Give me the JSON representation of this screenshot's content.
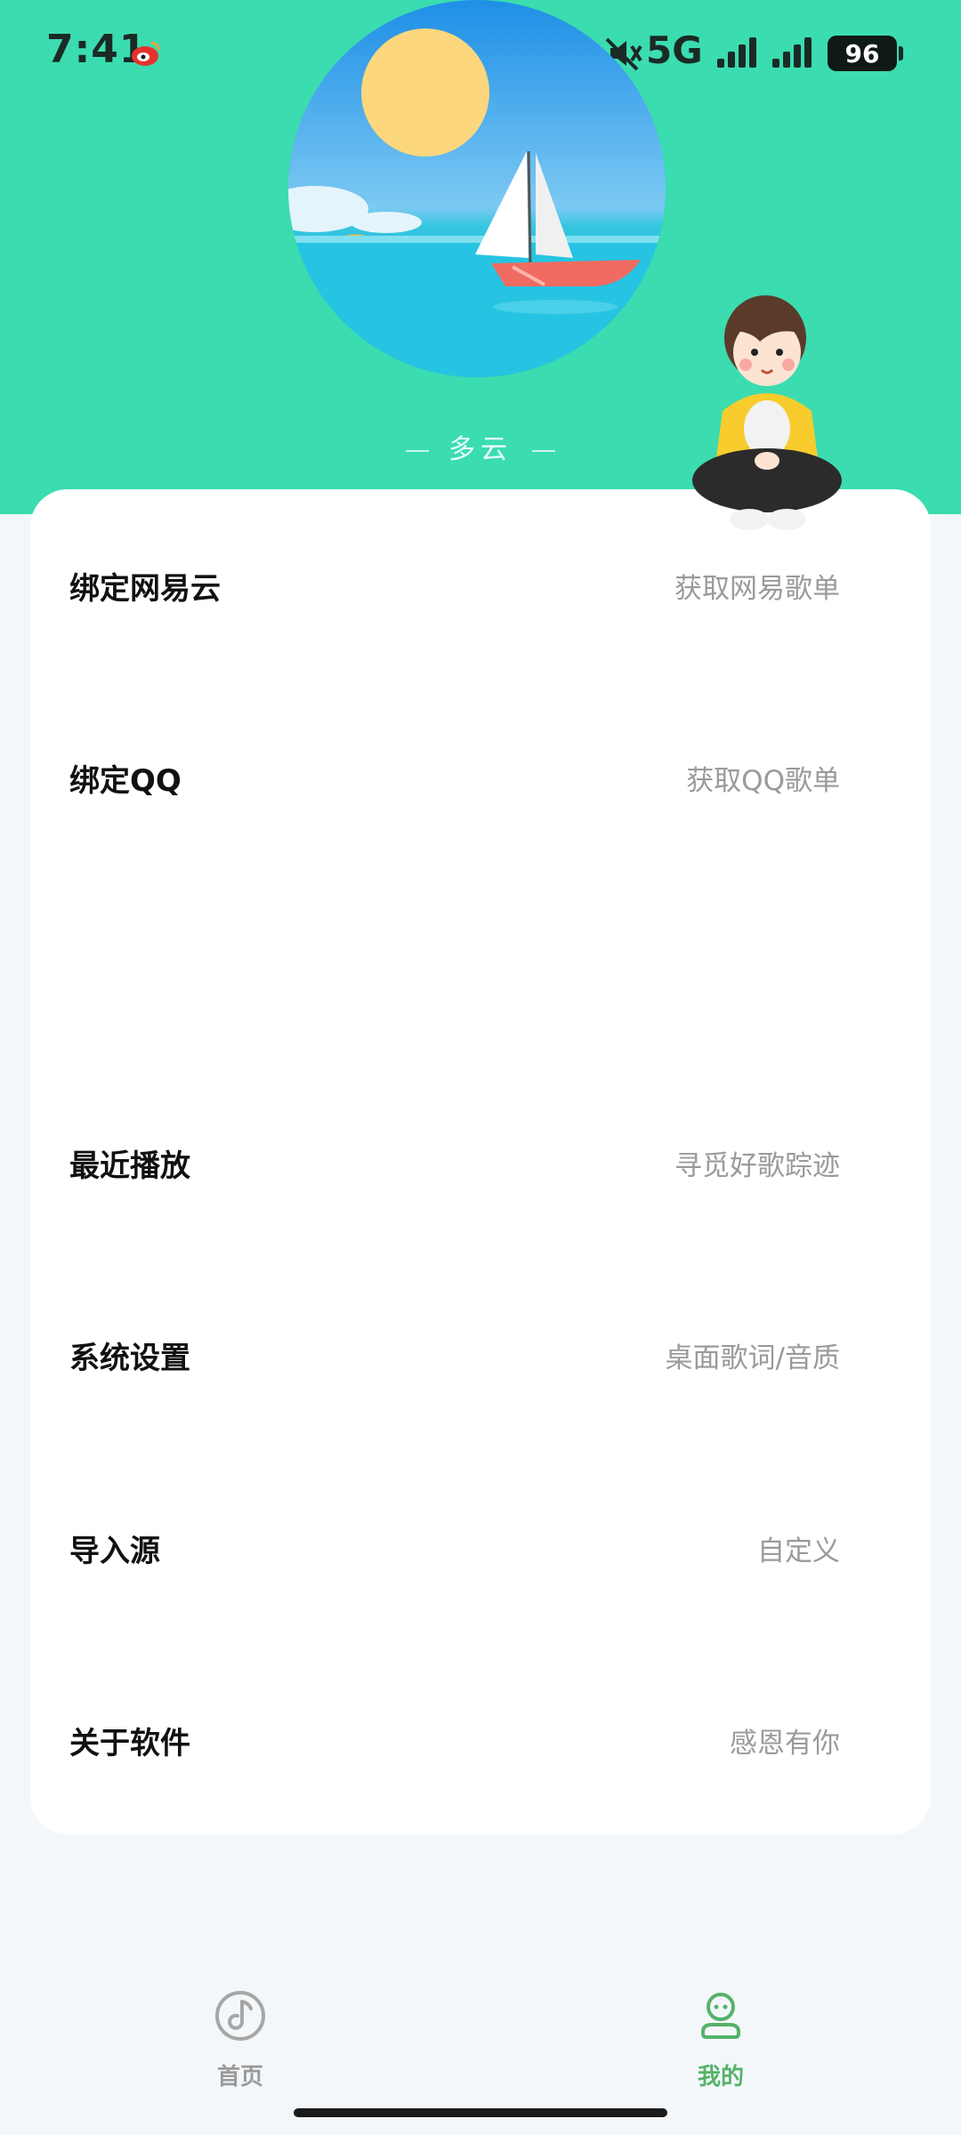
{
  "status_bar": {
    "time": "7:41",
    "network": "5G",
    "battery": "96"
  },
  "weather": {
    "label": "多云"
  },
  "menu": [
    {
      "title": "绑定网易云",
      "subtitle": "获取网易歌单"
    },
    {
      "title": "绑定QQ",
      "subtitle": "获取QQ歌单"
    },
    {
      "title": "最近播放",
      "subtitle": "寻觅好歌踪迹"
    },
    {
      "title": "系统设置",
      "subtitle": "桌面歌词/音质"
    },
    {
      "title": "导入源",
      "subtitle": "自定义"
    },
    {
      "title": "关于软件",
      "subtitle": "感恩有你"
    }
  ],
  "bottom_nav": [
    {
      "label": "首页",
      "icon": "music-disc-icon",
      "active": false
    },
    {
      "label": "我的",
      "icon": "user-icon",
      "active": true
    }
  ],
  "colors": {
    "header": "#3bdcb0",
    "active_tab": "#56b26a",
    "inactive_tab": "#9a9a9a"
  }
}
